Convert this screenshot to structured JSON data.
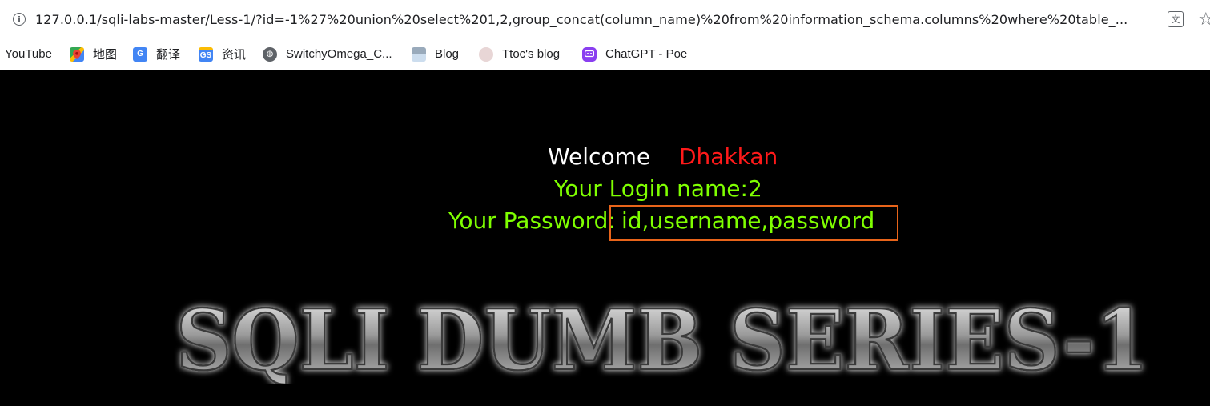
{
  "browser": {
    "url": "127.0.0.1/sqli-labs-master/Less-1/?id=-1%27%20union%20select%201,2,group_concat(column_name)%20from%20information_schema.columns%20where%20table_...",
    "translate_icon": "translate-icon",
    "star_icon": "star-icon"
  },
  "bookmarks": [
    {
      "label": "YouTube",
      "icon": "none"
    },
    {
      "label": "地图",
      "icon": "maps-icon"
    },
    {
      "label": "翻译",
      "icon": "translate-icon"
    },
    {
      "label": "资讯",
      "icon": "news-icon"
    },
    {
      "label": "SwitchyOmega_C...",
      "icon": "globe-icon"
    },
    {
      "label": "Blog",
      "icon": "blog-icon"
    },
    {
      "label": "Ttoc's blog",
      "icon": "avatar-icon"
    },
    {
      "label": "ChatGPT - Poe",
      "icon": "poe-icon"
    }
  ],
  "page": {
    "welcome": "Welcome",
    "name": "Dhakkan",
    "login": "Your Login name:2",
    "password_label": "Your Password:",
    "password_value": "id,username,password",
    "banner": "SQLI DUMB SERIES-1"
  },
  "colors": {
    "background": "#000000",
    "green": "#7fff00",
    "red": "#ff1a1a",
    "highlight": "#e8641a"
  }
}
